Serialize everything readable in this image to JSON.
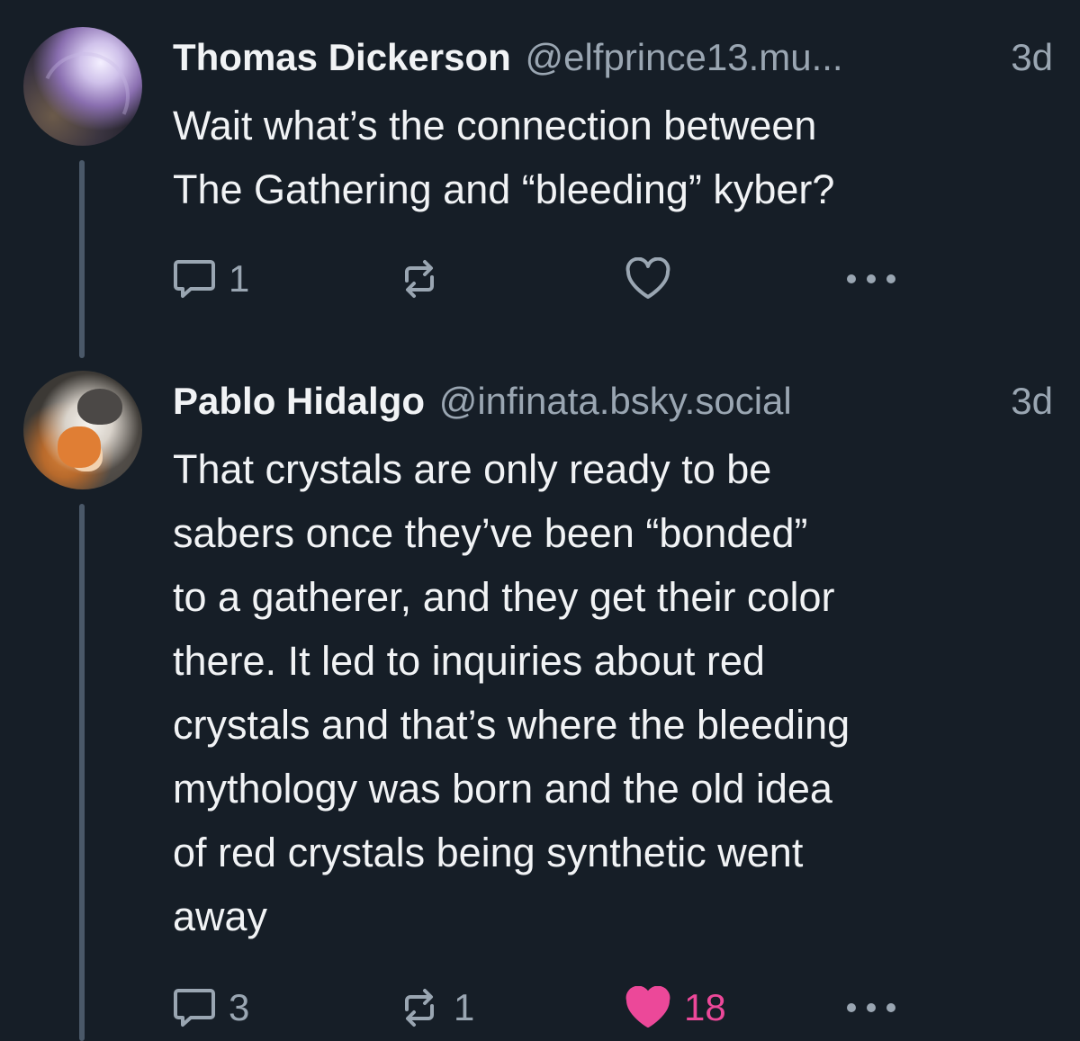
{
  "posts": [
    {
      "author_name": "Thomas Dickerson",
      "handle": "@elfprince13.mu...",
      "time": "3d",
      "text_lines": [
        "Wait what’s the connection between",
        "The Gathering and “bleeding” kyber?"
      ],
      "actions": {
        "reply_count": "1",
        "repost_count": "",
        "like_count": "",
        "liked": false
      }
    },
    {
      "author_name": "Pablo Hidalgo",
      "handle": "@infinata.bsky.social",
      "time": "3d",
      "text_lines": [
        "That crystals are only ready to be",
        "sabers once they’ve been “bonded”",
        "to a gatherer, and they get their color",
        "there. It led to inquiries about red",
        "crystals and that’s where the bleeding",
        "mythology was born and the old idea",
        "of red crystals being synthetic went",
        "away"
      ],
      "actions": {
        "reply_count": "3",
        "repost_count": "1",
        "like_count": "18",
        "liked": true
      }
    }
  ],
  "icons": {
    "reply": "speech-bubble-icon",
    "repost": "repost-arrows-icon",
    "like": "heart-icon",
    "more": "ellipsis-icon"
  },
  "colors": {
    "background": "#161e27",
    "text": "#f1f3f5",
    "muted": "#9aa6b2",
    "like_active": "#ec4899",
    "thread_line": "#4a5868"
  }
}
